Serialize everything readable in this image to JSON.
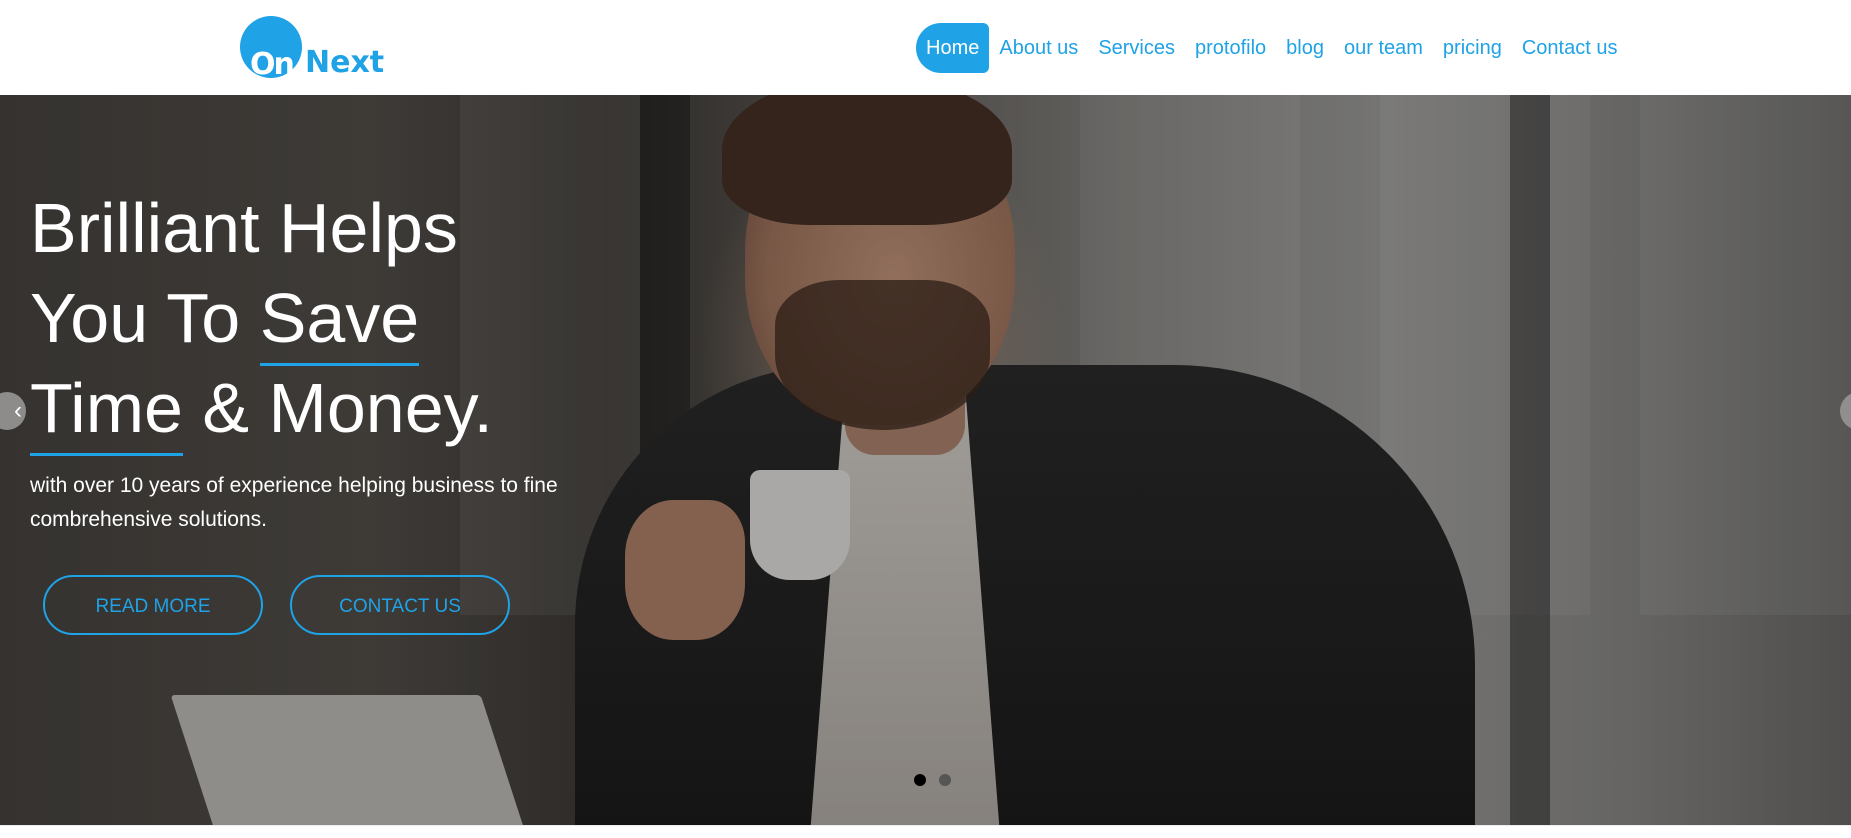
{
  "brand": {
    "logo_on": "On",
    "logo_next": "Next",
    "accent": "#1fa2e6"
  },
  "nav": {
    "items": [
      {
        "label": "Home",
        "active": true
      },
      {
        "label": "About us"
      },
      {
        "label": "Services"
      },
      {
        "label": "protofilo"
      },
      {
        "label": "blog"
      },
      {
        "label": "our team"
      },
      {
        "label": "pricing"
      },
      {
        "label": "Contact us"
      }
    ]
  },
  "hero": {
    "headline_line1": "Brilliant Helps",
    "headline_line2_a": "You To ",
    "headline_line2_b": "Save",
    "headline_line3_a": "Time",
    "headline_line3_b": " & Money.",
    "subtext": "with over 10 years of experience helping business to fine combrehensive solutions.",
    "read_more": "READ MORE",
    "contact_us": "CONTACT US",
    "prev_icon": "chevron-left-icon",
    "next_icon": "chevron-right-icon",
    "slides": {
      "count": 2,
      "active_index": 0
    }
  }
}
